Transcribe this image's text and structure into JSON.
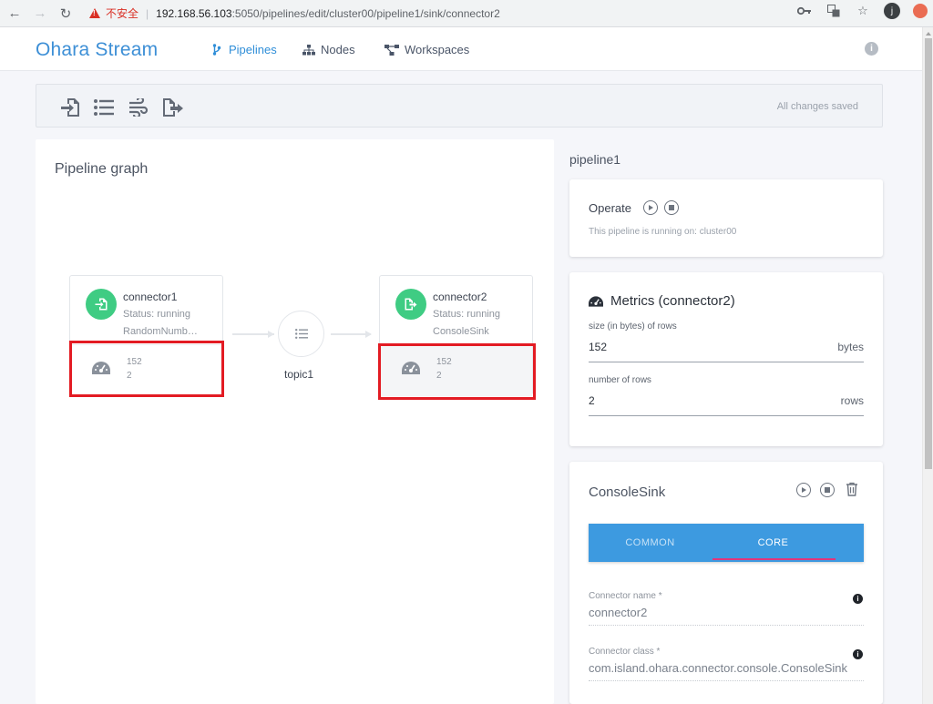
{
  "browser": {
    "insecure_label": "不安全",
    "url_host": "192.168.56.103",
    "url_rest": ":5050/pipelines/edit/cluster00/pipeline1/sink/connector2",
    "avatar_letter": "j"
  },
  "header": {
    "brand": "Ohara Stream",
    "nav": [
      {
        "label": "Pipelines",
        "icon": "branch-icon",
        "active": true
      },
      {
        "label": "Nodes",
        "icon": "sitemap-icon",
        "active": false
      },
      {
        "label": "Workspaces",
        "icon": "project-diagram-icon",
        "active": false
      }
    ],
    "info_icon": "i"
  },
  "toolbar": {
    "tools": [
      "source-connector-icon",
      "topic-list-icon",
      "stream-app-icon",
      "sink-connector-icon"
    ],
    "status": "All changes saved"
  },
  "graph": {
    "title": "Pipeline graph",
    "nodes": [
      {
        "name": "connector1",
        "status": "Status: running",
        "class": "RandomNumb…",
        "metric_a": "152",
        "metric_b": "2"
      },
      {
        "name": "connector2",
        "status": "Status: running",
        "class": "ConsoleSink",
        "metric_a": "152",
        "metric_b": "2"
      }
    ],
    "topic": {
      "name": "topic1"
    }
  },
  "sidebar": {
    "pipeline_name": "pipeline1",
    "operate": {
      "title": "Operate",
      "description": "This pipeline is running on: cluster00"
    },
    "metrics": {
      "title": "Metrics (connector2)",
      "fields": [
        {
          "label": "size (in bytes) of rows",
          "value": "152",
          "unit": "bytes"
        },
        {
          "label": "number of rows",
          "value": "2",
          "unit": "rows"
        }
      ]
    },
    "connector": {
      "title": "ConsoleSink",
      "tabs": [
        "COMMON",
        "CORE"
      ],
      "active_tab": "CORE",
      "fields": [
        {
          "label": "Connector name *",
          "value": "connector2"
        },
        {
          "label": "Connector class *",
          "value": "com.island.ohara.connector.console.ConsoleSink"
        }
      ]
    }
  },
  "colors": {
    "brand": "#3d8fd6",
    "node_green": "#3fcc83",
    "tab_blue": "#3d9ae0",
    "tab_indicator": "#e0357c",
    "highlight_red": "#e31b23"
  }
}
